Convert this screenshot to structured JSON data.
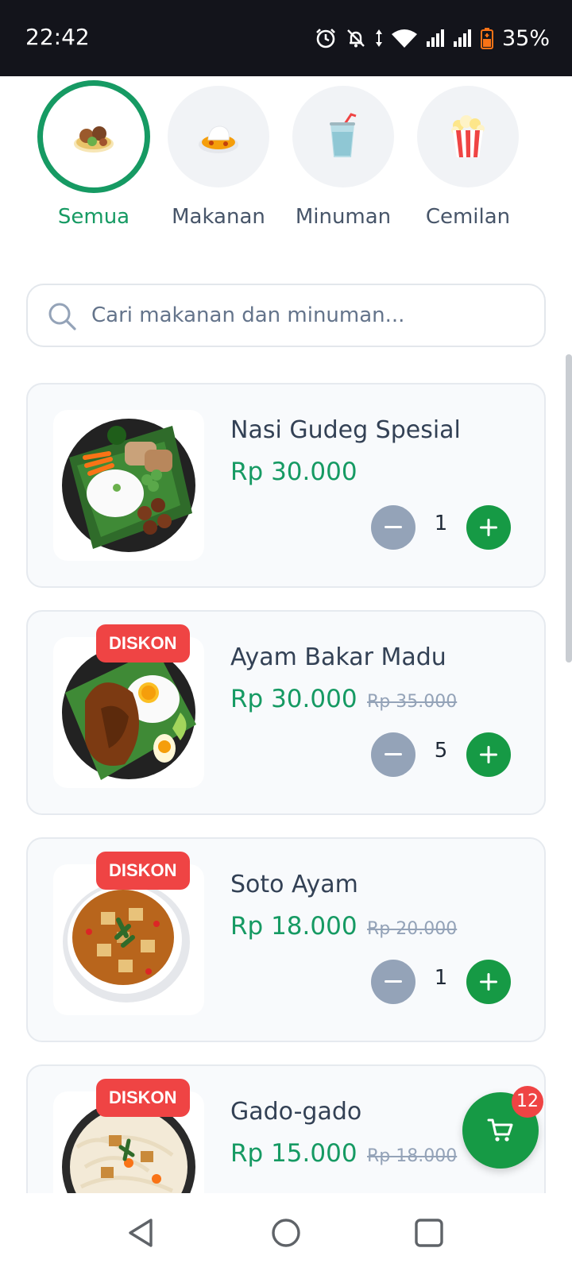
{
  "status_bar": {
    "time": "22:42",
    "battery": "35%",
    "icons": [
      "alarm-icon",
      "notifications-off-icon",
      "data-arrows-icon",
      "wifi-icon",
      "signal-icon",
      "signal-icon",
      "battery-icon"
    ]
  },
  "categories": [
    {
      "label": "Semua",
      "icon": "mixed-food-icon",
      "active": true
    },
    {
      "label": "Makanan",
      "icon": "rice-plate-icon",
      "active": false
    },
    {
      "label": "Minuman",
      "icon": "drink-cup-icon",
      "active": false
    },
    {
      "label": "Cemilan",
      "icon": "popcorn-icon",
      "active": false
    }
  ],
  "search": {
    "placeholder": "Cari makanan dan minuman...",
    "value": ""
  },
  "products": [
    {
      "name": "Nasi Gudeg Spesial",
      "price": "Rp 30.000",
      "old_price": "",
      "badge": "",
      "quantity": "1"
    },
    {
      "name": "Ayam Bakar Madu",
      "price": "Rp 30.000",
      "old_price": "Rp 35.000",
      "badge": "DISKON",
      "quantity": "5"
    },
    {
      "name": "Soto Ayam",
      "price": "Rp 18.000",
      "old_price": "Rp 20.000",
      "badge": "DISKON",
      "quantity": "1"
    },
    {
      "name": "Gado-gado",
      "price": "Rp 15.000",
      "old_price": "Rp 18.000",
      "badge": "DISKON",
      "quantity": ""
    }
  ],
  "cart": {
    "count": "12"
  },
  "colors": {
    "accent": "#169a63",
    "button_green": "#169a45",
    "badge_red": "#ef4444",
    "stepper_gray": "#94a3b8"
  }
}
